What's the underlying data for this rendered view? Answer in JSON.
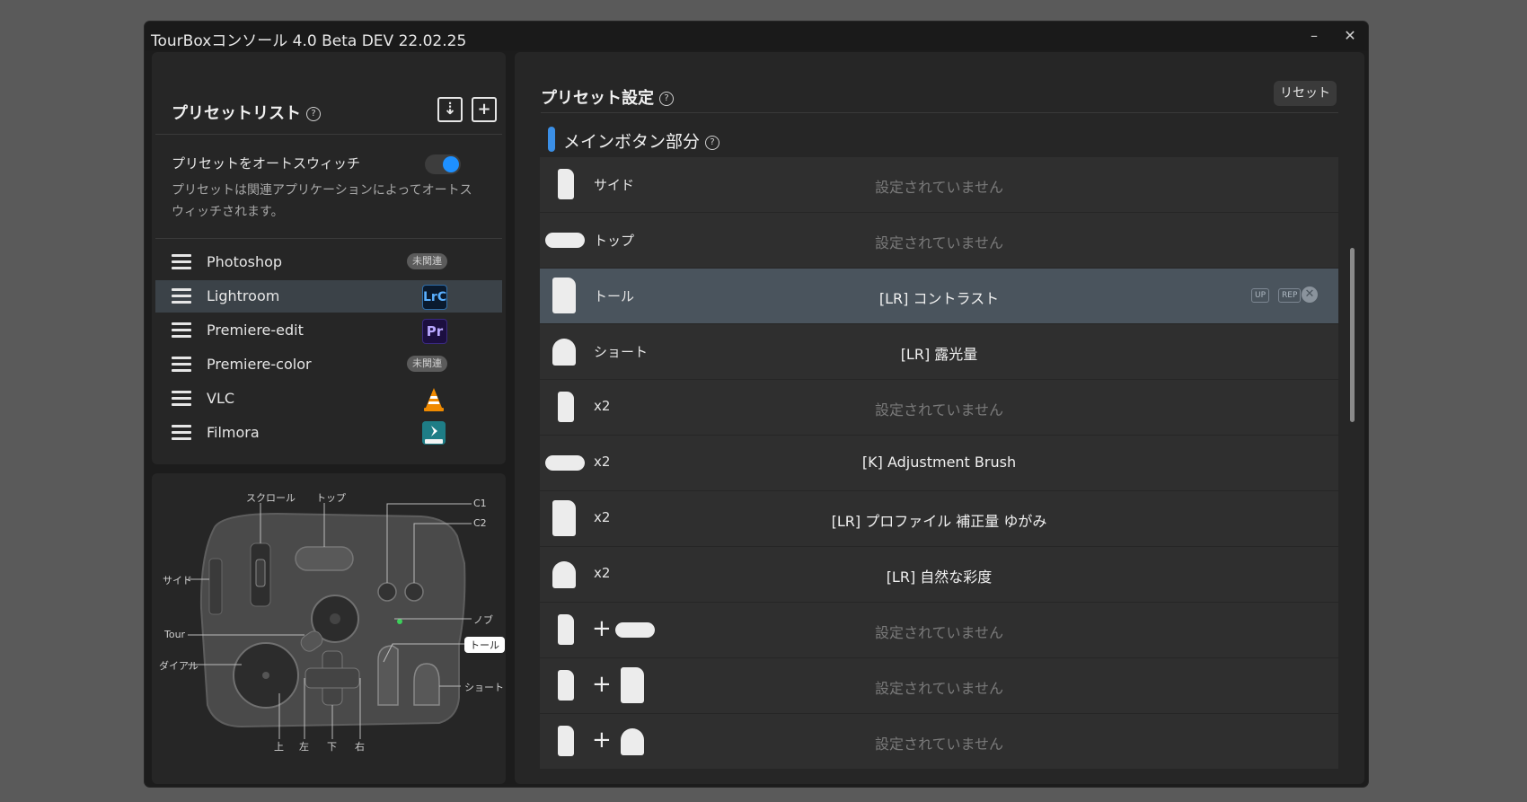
{
  "window": {
    "title": "TourBoxコンソール 4.0 Beta DEV 22.02.25",
    "minimize": "–",
    "close": "✕"
  },
  "preset_list": {
    "title": "プリセットリスト",
    "help": "?",
    "import_icon": "import-icon",
    "add_icon": "add-icon",
    "auto_switch_label": "プリセットをオートスウィッチ",
    "auto_switch_on": true,
    "auto_switch_desc": "プリセットは関連アプリケーションによってオートスウィッチされます。",
    "items": [
      {
        "name": "Photoshop",
        "badge": "未関連"
      },
      {
        "name": "Lightroom",
        "icon_text": "LrC",
        "selected": true
      },
      {
        "name": "Premiere-edit",
        "icon_text": "Pr"
      },
      {
        "name": "Premiere-color",
        "badge": "未関連"
      },
      {
        "name": "VLC"
      },
      {
        "name": "Filmora"
      }
    ]
  },
  "device": {
    "labels": {
      "scroll": "スクロール",
      "top": "トップ",
      "c1": "C1",
      "c2": "C2",
      "side": "サイド",
      "knob": "ノブ",
      "tour": "Tour",
      "tall": "トール",
      "dial": "ダイアル",
      "short": "ショート",
      "up": "上",
      "left": "左",
      "down": "下",
      "right": "右"
    }
  },
  "preset_settings": {
    "title": "プリセット設定",
    "help": "?",
    "reset": "リセット",
    "section": "メインボタン部分",
    "tags": {
      "up": "UP",
      "rep": "REP"
    },
    "plus": "+",
    "rows": [
      {
        "button": "サイド",
        "action": "設定されていません"
      },
      {
        "button": "トップ",
        "action": "設定されていません"
      },
      {
        "button": "トール",
        "action": "[LR] コントラスト"
      },
      {
        "button": "ショート",
        "action": "[LR] 露光量"
      },
      {
        "button": "x2",
        "action": "設定されていません"
      },
      {
        "button": "x2",
        "action": "[K] Adjustment Brush"
      },
      {
        "button": "x2",
        "action": "[LR] プロファイル 補正量 ゆがみ"
      },
      {
        "button": "x2",
        "action": "[LR] 自然な彩度"
      },
      {
        "action": "設定されていません"
      },
      {
        "action": "設定されていません"
      },
      {
        "action": "設定されていません"
      }
    ]
  }
}
